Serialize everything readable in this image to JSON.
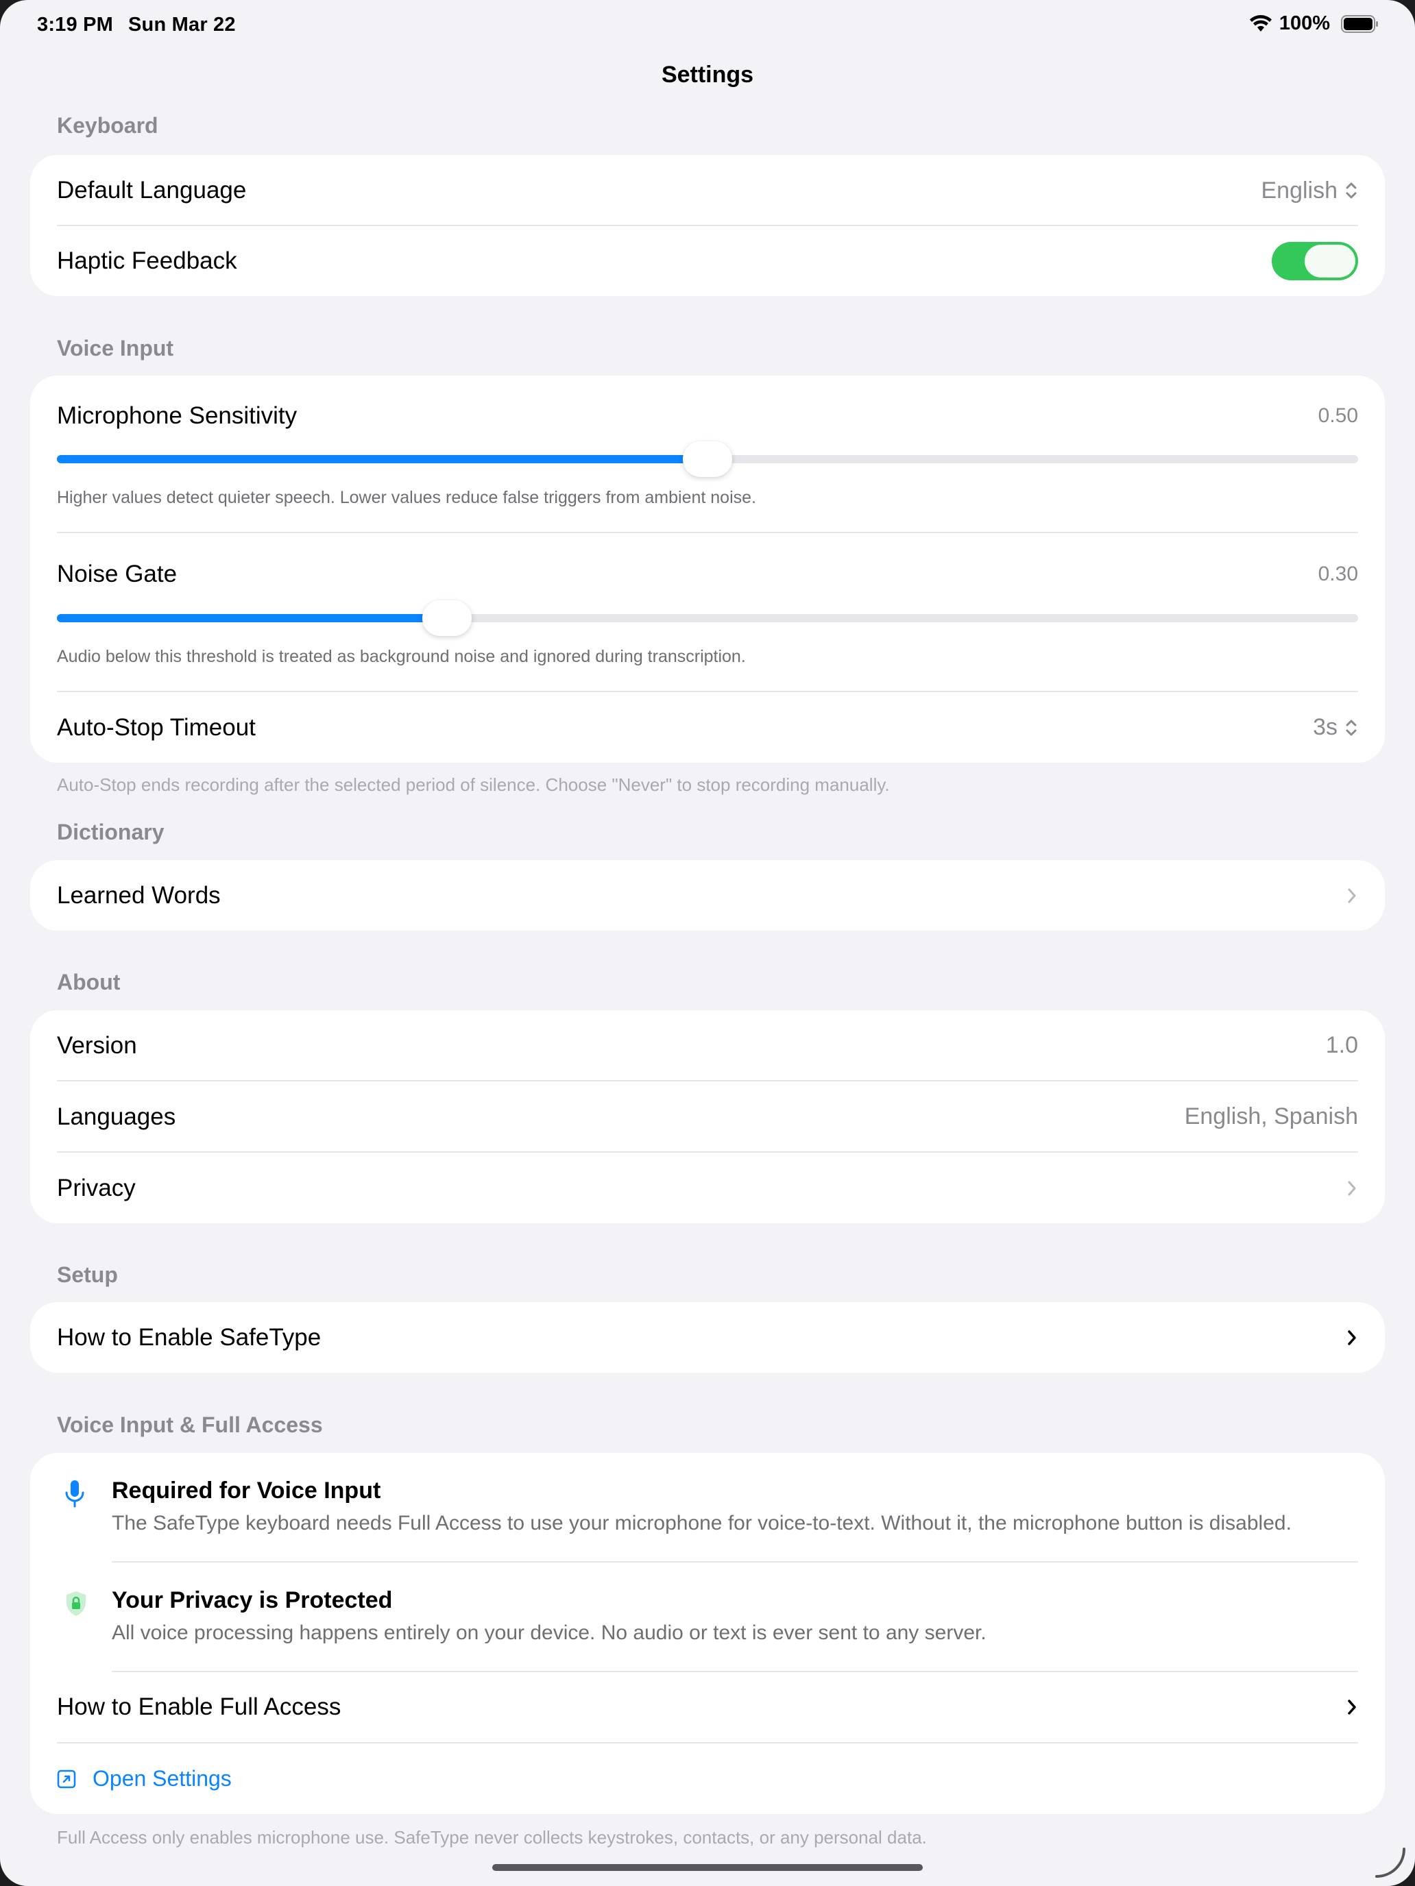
{
  "status_bar": {
    "time": "3:19 PM",
    "date": "Sun Mar 22",
    "battery": "100%"
  },
  "nav": {
    "title": "Settings"
  },
  "keyboard": {
    "header": "Keyboard",
    "default_language_label": "Default Language",
    "default_language_value": "English",
    "haptic_label": "Haptic Feedback",
    "haptic_on": true
  },
  "voice": {
    "header": "Voice Input",
    "mic_label": "Microphone Sensitivity",
    "mic_value": "0.50",
    "mic_level": 0.5,
    "mic_hint": "Higher values detect quieter speech. Lower values reduce false triggers from ambient noise.",
    "gate_label": "Noise Gate",
    "gate_value": "0.30",
    "gate_level": 0.3,
    "gate_hint": "Audio below this threshold is treated as background noise and ignored during transcription.",
    "autostop_label": "Auto-Stop Timeout",
    "autostop_value": "3s",
    "footnote": "Auto-Stop ends recording after the selected period of silence. Choose \"Never\" to stop recording manually."
  },
  "dictionary": {
    "header": "Dictionary",
    "learned_words_label": "Learned Words"
  },
  "about": {
    "header": "About",
    "version_label": "Version",
    "version_value": "1.0",
    "languages_label": "Languages",
    "languages_value": "English, Spanish",
    "privacy_label": "Privacy"
  },
  "setup": {
    "header": "Setup",
    "enable_label": "How to Enable SafeType"
  },
  "full_access": {
    "header": "Voice Input & Full Access",
    "required_title": "Required for Voice Input",
    "required_desc": "The SafeType keyboard needs Full Access to use your microphone for voice-to-text. Without it, the microphone button is disabled.",
    "privacy_title": "Your Privacy is Protected",
    "privacy_desc": "All voice processing happens entirely on your device. No audio or text is ever sent to any server.",
    "enable_label": "How to Enable Full Access",
    "open_settings_label": "Open Settings",
    "footnote": "Full Access only enables microphone use. SafeType never collects keystrokes, contacts, or any personal data."
  },
  "colors": {
    "accent": "#0a84ff",
    "toggle_on": "#34c759",
    "secondary_text": "#8a8a8e",
    "background": "#f2f2f7"
  }
}
